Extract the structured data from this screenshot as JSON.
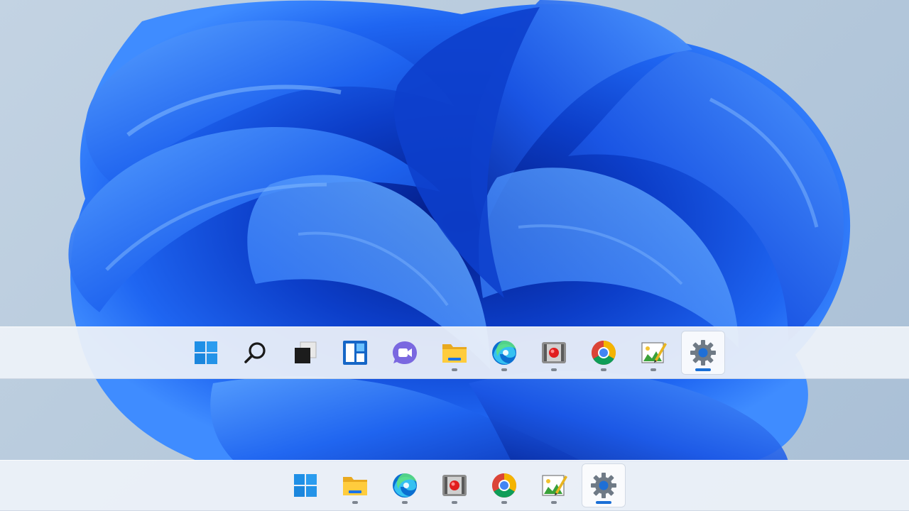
{
  "desktop": {
    "wallpaper": "windows-11-bloom",
    "colors": {
      "background": "#bccfe0",
      "bloom_dark": "#0a2fb0",
      "bloom_mid": "#1a5bf0",
      "bloom_light": "#4a90ff"
    }
  },
  "taskbar_top": {
    "items": [
      {
        "icon": "start-icon",
        "running": false,
        "active": false
      },
      {
        "icon": "search-icon",
        "running": false,
        "active": false
      },
      {
        "icon": "task-view-icon",
        "running": false,
        "active": false
      },
      {
        "icon": "widgets-icon",
        "running": false,
        "active": false
      },
      {
        "icon": "chat-icon",
        "running": false,
        "active": false
      },
      {
        "icon": "file-explorer-icon",
        "running": true,
        "active": false
      },
      {
        "icon": "edge-icon",
        "running": true,
        "active": false
      },
      {
        "icon": "screen-recorder-icon",
        "running": true,
        "active": false
      },
      {
        "icon": "chrome-icon",
        "running": true,
        "active": false
      },
      {
        "icon": "image-editor-icon",
        "running": true,
        "active": false
      },
      {
        "icon": "settings-icon",
        "running": true,
        "active": true
      }
    ]
  },
  "taskbar_bottom": {
    "items": [
      {
        "icon": "start-icon",
        "running": false,
        "active": false
      },
      {
        "icon": "file-explorer-icon",
        "running": true,
        "active": false
      },
      {
        "icon": "edge-icon",
        "running": true,
        "active": false
      },
      {
        "icon": "screen-recorder-icon",
        "running": true,
        "active": false
      },
      {
        "icon": "chrome-icon",
        "running": true,
        "active": false
      },
      {
        "icon": "image-editor-icon",
        "running": true,
        "active": false
      },
      {
        "icon": "settings-icon",
        "running": true,
        "active": true
      }
    ]
  }
}
